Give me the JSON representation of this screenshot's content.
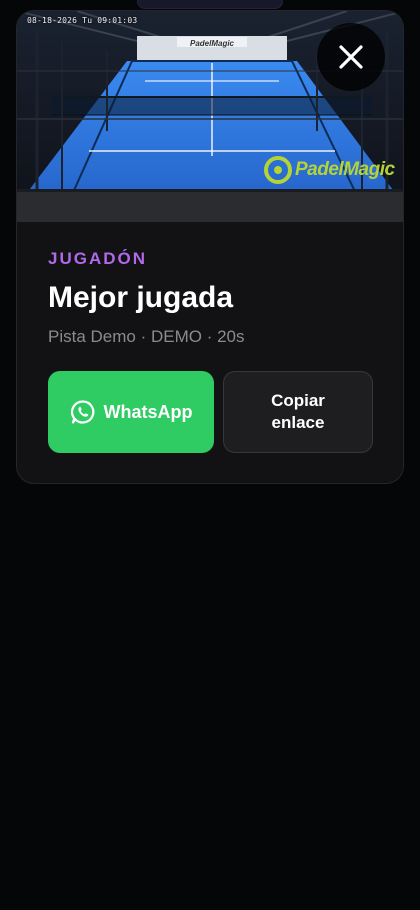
{
  "video": {
    "timestamp": "08-18-2026 Tu 09:01:03",
    "brand_left": "Padel",
    "brand_right": "Magic",
    "banner_text": "PadelMagic"
  },
  "close": {
    "icon": "close-icon"
  },
  "clip": {
    "category": "JUGADÓN",
    "title": "Mejor jugada",
    "meta": "Pista Demo · DEMO · 20s"
  },
  "actions": {
    "whatsapp_label": "WhatsApp",
    "whatsapp_icon": "whatsapp-icon",
    "copy_label": "Copiar enlace"
  },
  "colors": {
    "accent_purple": "#b069e9",
    "whatsapp_green": "#2ecc63",
    "background": "#050608",
    "card": "#121214",
    "court_blue": "#2f7be8"
  }
}
